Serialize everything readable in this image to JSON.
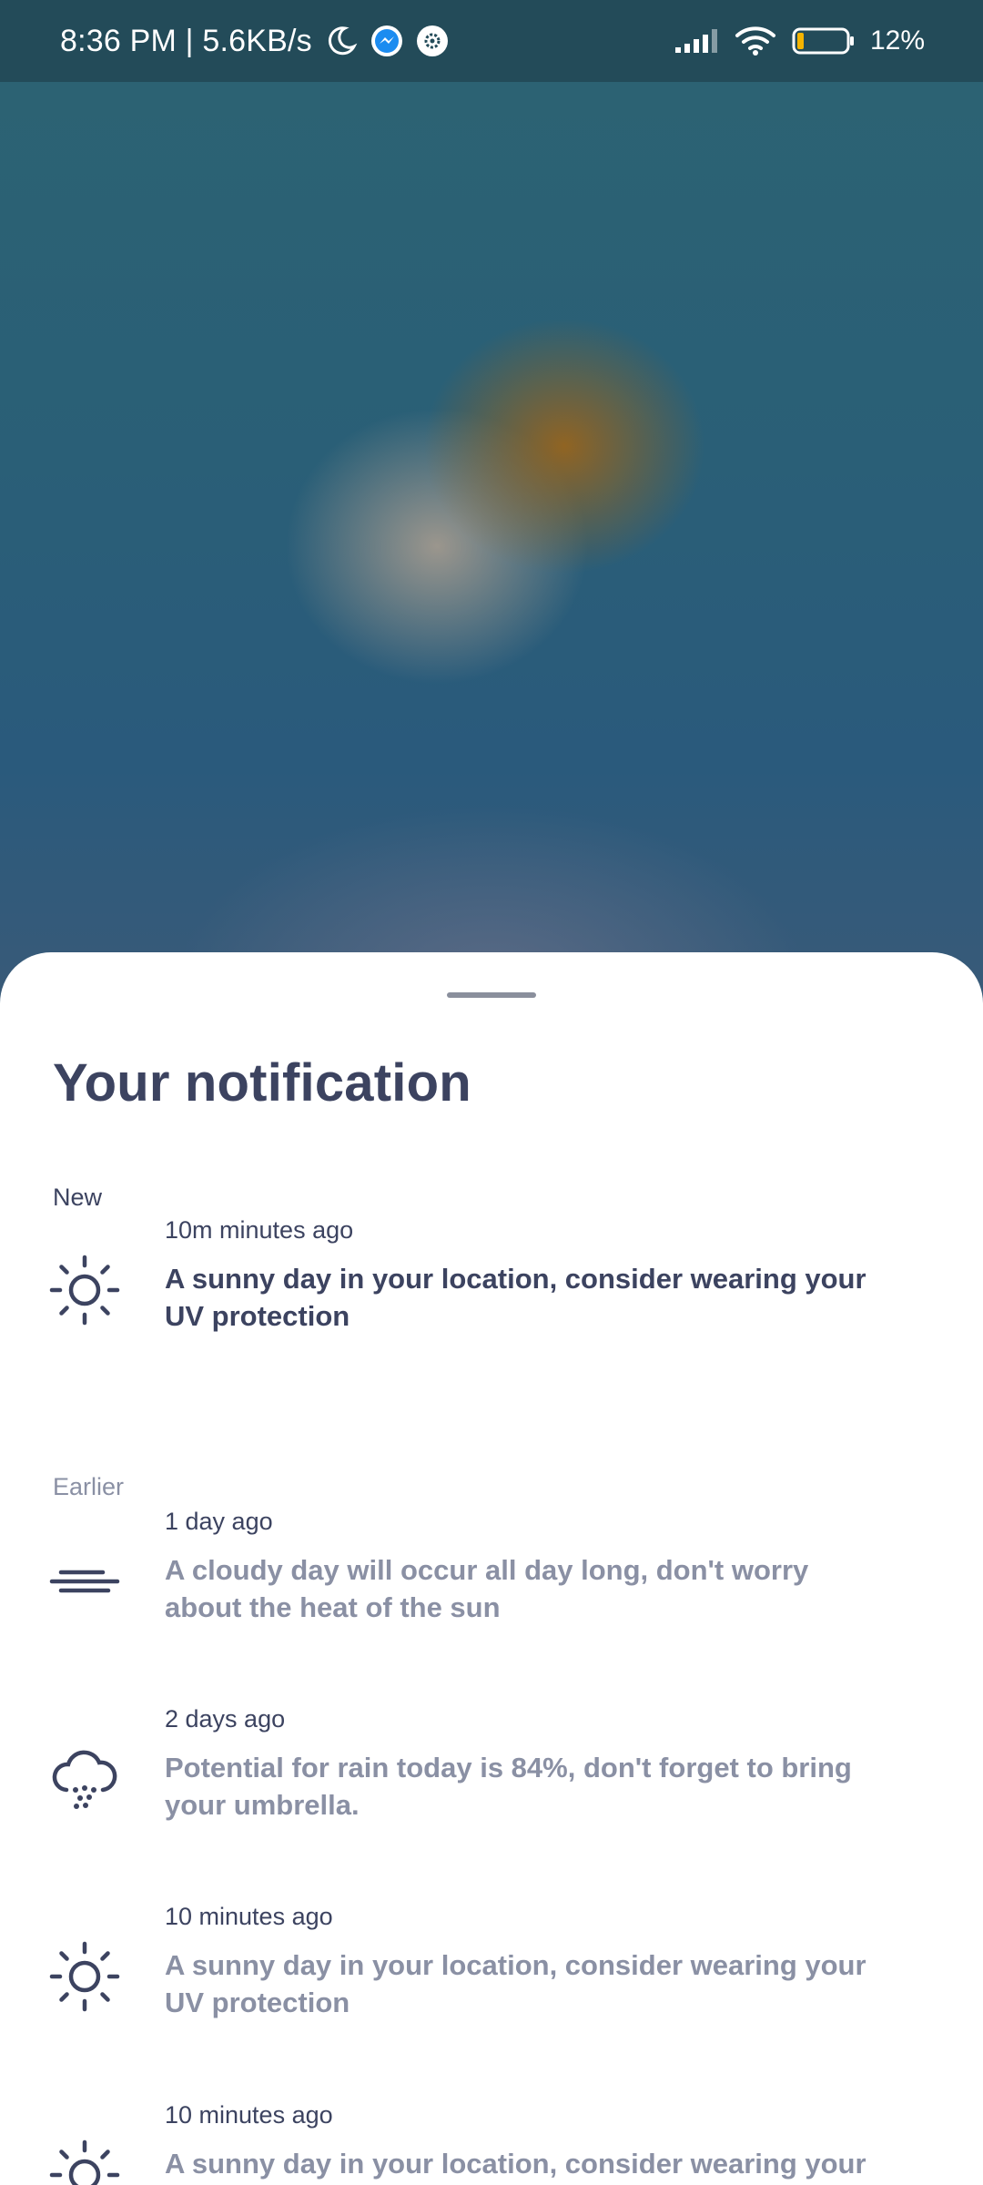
{
  "status_bar": {
    "time_speed": "8:36 PM | 5.6KB/s",
    "battery_percent": "12%",
    "icons": [
      "moon-icon",
      "messenger-icon",
      "settings-badge-icon",
      "signal-icon",
      "wifi-icon",
      "battery-icon"
    ]
  },
  "sheet": {
    "title": "Your notification",
    "sections": {
      "new": "New",
      "earlier": "Earlier"
    },
    "notifications": [
      {
        "time": "10m minutes ago",
        "message": "A sunny day in your location, consider wearing your UV protection",
        "icon": "sun-icon",
        "read": false
      },
      {
        "time": "1 day ago",
        "message": "A cloudy day will occur all day long, don't worry about the heat of the sun",
        "icon": "wind-icon",
        "read": true
      },
      {
        "time": "2 days ago",
        "message": "Potential for rain today is 84%, don't forget to bring your umbrella.",
        "icon": "rain-cloud-icon",
        "read": true
      },
      {
        "time": "10 minutes ago",
        "message": "A sunny day in your location, consider wearing your UV protection",
        "icon": "sun-icon",
        "read": true
      },
      {
        "time": "10 minutes ago",
        "message": "A sunny day in your location, consider wearing your UV protection",
        "icon": "sun-icon",
        "read": true
      }
    ]
  },
  "colors": {
    "status_bar_bg": "#234b59",
    "text_active": "#3c4360",
    "text_read": "#8a90a4",
    "sheet_bg": "#ffffff"
  }
}
